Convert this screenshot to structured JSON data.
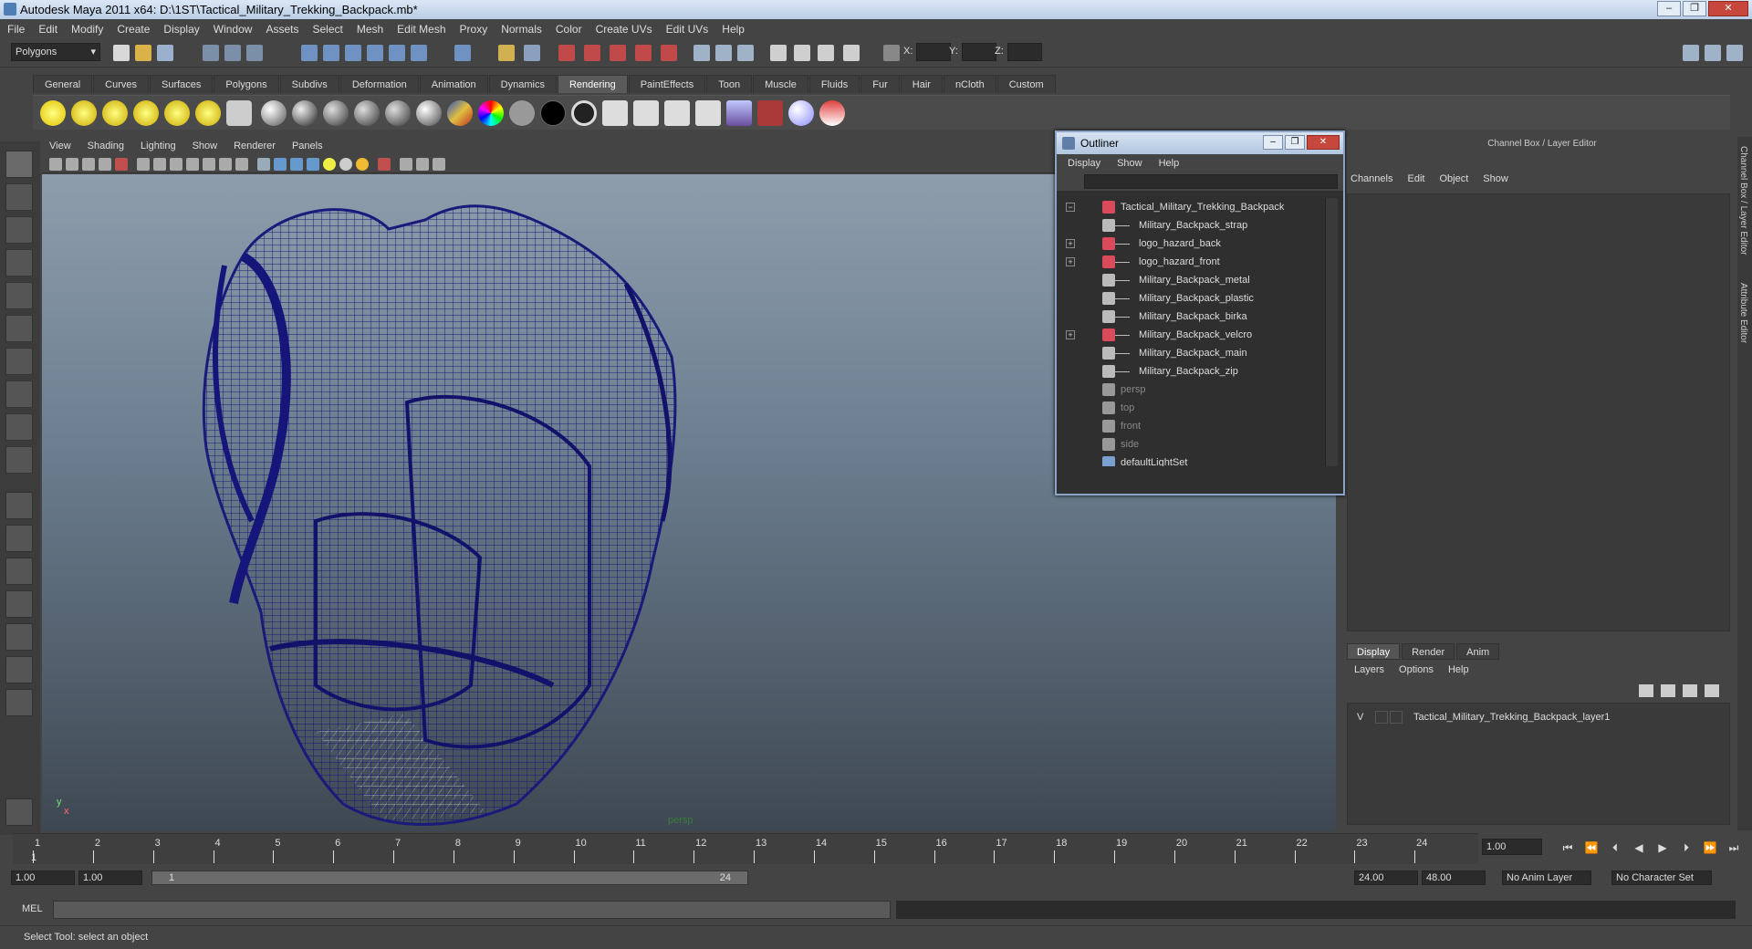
{
  "window": {
    "title": "Autodesk Maya 2011 x64: D:\\1ST\\Tactical_Military_Trekking_Backpack.mb*",
    "minimize": "–",
    "maximize": "❐",
    "close": "✕"
  },
  "menubar": [
    "File",
    "Edit",
    "Modify",
    "Create",
    "Display",
    "Window",
    "Assets",
    "Select",
    "Mesh",
    "Edit Mesh",
    "Proxy",
    "Normals",
    "Color",
    "Create UVs",
    "Edit UVs",
    "Help"
  ],
  "status": {
    "menu_set": "Polygons",
    "x_label": "X:",
    "y_label": "Y:",
    "z_label": "Z:"
  },
  "shelf_tabs": [
    "General",
    "Curves",
    "Surfaces",
    "Polygons",
    "Subdivs",
    "Deformation",
    "Animation",
    "Dynamics",
    "Rendering",
    "PaintEffects",
    "Toon",
    "Muscle",
    "Fluids",
    "Fur",
    "Hair",
    "nCloth",
    "Custom"
  ],
  "shelf_active": "Rendering",
  "viewport": {
    "menu": [
      "View",
      "Shading",
      "Lighting",
      "Show",
      "Renderer",
      "Panels"
    ],
    "camera_label": "persp",
    "axis_y": "y",
    "axis_x": "x",
    "wire_color": "#1a1a7a"
  },
  "outliner": {
    "title": "Outliner",
    "menu": [
      "Display",
      "Show",
      "Help"
    ],
    "items": [
      {
        "name": "Tactical_Military_Trekking_Backpack",
        "expander": "−",
        "icon": "shader",
        "dim": false
      },
      {
        "name": "Military_Backpack_strap",
        "expander": "",
        "icon": "mesh",
        "dim": false
      },
      {
        "name": "logo_hazard_back",
        "expander": "+",
        "icon": "shader",
        "dim": false
      },
      {
        "name": "logo_hazard_front",
        "expander": "+",
        "icon": "shader",
        "dim": false
      },
      {
        "name": "Military_Backpack_metal",
        "expander": "",
        "icon": "mesh",
        "dim": false
      },
      {
        "name": "Military_Backpack_plastic",
        "expander": "",
        "icon": "mesh",
        "dim": false
      },
      {
        "name": "Military_Backpack_birka",
        "expander": "",
        "icon": "mesh",
        "dim": false
      },
      {
        "name": "Military_Backpack_velcro",
        "expander": "+",
        "icon": "shader",
        "dim": false
      },
      {
        "name": "Military_Backpack_main",
        "expander": "",
        "icon": "mesh",
        "dim": false
      },
      {
        "name": "Military_Backpack_zip",
        "expander": "",
        "icon": "mesh",
        "dim": false
      },
      {
        "name": "persp",
        "expander": "",
        "icon": "camera",
        "dim": true
      },
      {
        "name": "top",
        "expander": "",
        "icon": "camera",
        "dim": true
      },
      {
        "name": "front",
        "expander": "",
        "icon": "camera",
        "dim": true
      },
      {
        "name": "side",
        "expander": "",
        "icon": "camera",
        "dim": true
      },
      {
        "name": "defaultLightSet",
        "expander": "",
        "icon": "set",
        "dim": false
      }
    ]
  },
  "channel_box": {
    "title": "Channel Box / Layer Editor",
    "menu": [
      "Channels",
      "Edit",
      "Object",
      "Show"
    ],
    "layer_tabs": [
      "Display",
      "Render",
      "Anim"
    ],
    "layer_active": "Display",
    "layer_menu": [
      "Layers",
      "Options",
      "Help"
    ],
    "layer": {
      "visible": "V",
      "name": "Tactical_Military_Trekking_Backpack_layer1"
    }
  },
  "side_tabs": [
    "Channel Box / Layer Editor",
    "Attribute Editor"
  ],
  "timeline": {
    "ticks": [
      "1",
      "2",
      "3",
      "4",
      "5",
      "6",
      "7",
      "8",
      "9",
      "10",
      "11",
      "12",
      "13",
      "14",
      "15",
      "16",
      "17",
      "18",
      "19",
      "20",
      "21",
      "22",
      "23",
      "24"
    ],
    "current_frame": "1",
    "current_field": "1.00"
  },
  "range": {
    "start": "1.00",
    "playback_start": "1.00",
    "bar_start": "1",
    "bar_end": "24",
    "playback_end": "24.00",
    "end": "48.00",
    "anim_layer": "No Anim Layer",
    "char_set": "No Character Set"
  },
  "command": {
    "label": "MEL"
  },
  "help_line": "Select Tool: select an object"
}
